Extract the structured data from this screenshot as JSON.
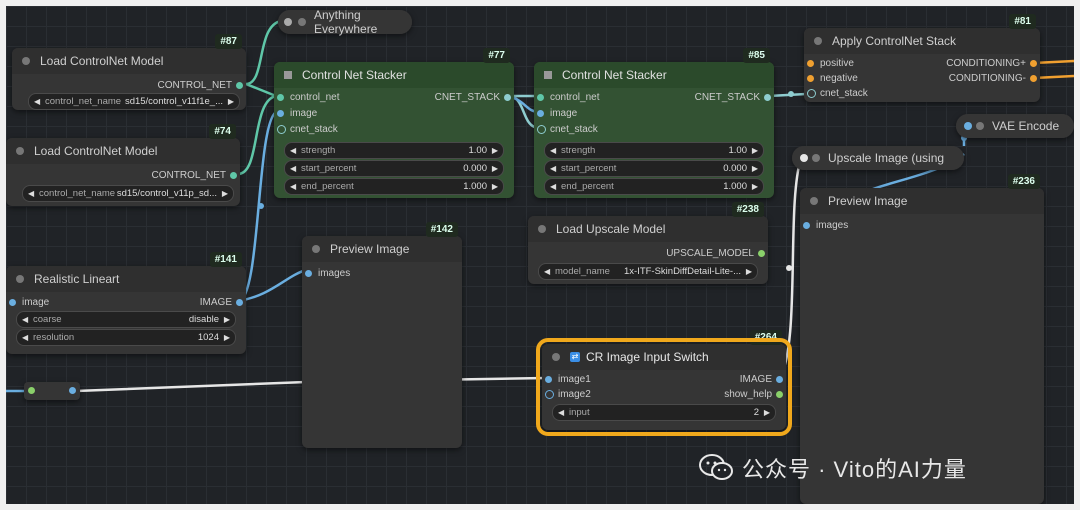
{
  "nodes": {
    "anything_everywhere": {
      "title": "Anything Everywhere"
    },
    "load_cn_87": {
      "id": "#87",
      "title": "Load ControlNet Model",
      "output": "CONTROL_NET",
      "widget_name": "control_net_name",
      "widget_value": "sd15/control_v11f1e_..."
    },
    "load_cn_74": {
      "id": "#74",
      "title": "Load ControlNet Model",
      "output": "CONTROL_NET",
      "widget_name": "control_net_name",
      "widget_value": "sd15/control_v11p_sd..."
    },
    "stacker_77": {
      "id": "#77",
      "title": "Control Net Stacker",
      "inputs": [
        "control_net",
        "image",
        "cnet_stack"
      ],
      "output": "CNET_STACK",
      "widgets": [
        {
          "name": "strength",
          "value": "1.00"
        },
        {
          "name": "start_percent",
          "value": "0.000"
        },
        {
          "name": "end_percent",
          "value": "1.000"
        }
      ]
    },
    "stacker_85": {
      "id": "#85",
      "title": "Control Net Stacker",
      "inputs": [
        "control_net",
        "image",
        "cnet_stack"
      ],
      "output": "CNET_STACK",
      "widgets": [
        {
          "name": "strength",
          "value": "1.00"
        },
        {
          "name": "start_percent",
          "value": "0.000"
        },
        {
          "name": "end_percent",
          "value": "1.000"
        }
      ]
    },
    "apply_81": {
      "id": "#81",
      "title": "Apply ControlNet Stack",
      "inputs": [
        "positive",
        "negative",
        "cnet_stack"
      ],
      "outputs": [
        "CONDITIONING+",
        "CONDITIONING-"
      ]
    },
    "vae_encode": {
      "title": "VAE Encode"
    },
    "upscale_image": {
      "title": "Upscale Image (using"
    },
    "preview_236": {
      "id": "#236",
      "title": "Preview Image",
      "input": "images"
    },
    "load_upscale_238": {
      "id": "#238",
      "title": "Load Upscale Model",
      "output": "UPSCALE_MODEL",
      "widget_name": "model_name",
      "widget_value": "1x-ITF-SkinDiffDetail-Lite-..."
    },
    "preview_142": {
      "id": "#142",
      "title": "Preview Image",
      "input": "images"
    },
    "lineart_141": {
      "id": "#141",
      "title": "Realistic Lineart",
      "input": "image",
      "output": "IMAGE",
      "widgets": [
        {
          "name": "coarse",
          "value": "disable"
        },
        {
          "name": "resolution",
          "value": "1024"
        }
      ]
    },
    "switch_264": {
      "id": "#264",
      "title": "CR Image Input Switch",
      "inputs": [
        "image1",
        "image2"
      ],
      "outputs": [
        "IMAGE",
        "show_help"
      ],
      "widget_name": "input",
      "widget_value": "2"
    }
  },
  "watermark": {
    "text": "公众号 · Vito的AI力量",
    "icon": "wechat-icon"
  },
  "colors": {
    "highlight": "#f0a81c",
    "image_wire": "#64b5f6",
    "controlnet_wire": "#00d78d",
    "conditioning_wire": "#ffa931",
    "green_node": "#335233"
  }
}
